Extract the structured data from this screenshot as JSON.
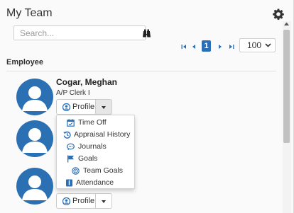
{
  "header": {
    "title": "My Team"
  },
  "search": {
    "placeholder": "Search..."
  },
  "pager": {
    "current_page": "1",
    "page_size": "100"
  },
  "table": {
    "column_header": "Employee"
  },
  "employees": [
    {
      "name": "Cogar, Meghan",
      "role": "A/P Clerk I",
      "profile_label": "Profile"
    },
    {
      "profile_label": "Profile"
    }
  ],
  "dropdown_menu": {
    "items": [
      {
        "label": "Time Off",
        "icon": "calendar-icon"
      },
      {
        "label": "Appraisal History",
        "icon": "history-icon"
      },
      {
        "label": "Journals",
        "icon": "comment-icon"
      },
      {
        "label": "Goals",
        "icon": "flag-icon"
      },
      {
        "label": "Team Goals",
        "icon": "team-goals-icon"
      },
      {
        "label": "Attendance",
        "icon": "attendance-icon"
      }
    ]
  },
  "colors": {
    "accent": "#2a6fb5",
    "avatar": "#2c70b4"
  }
}
